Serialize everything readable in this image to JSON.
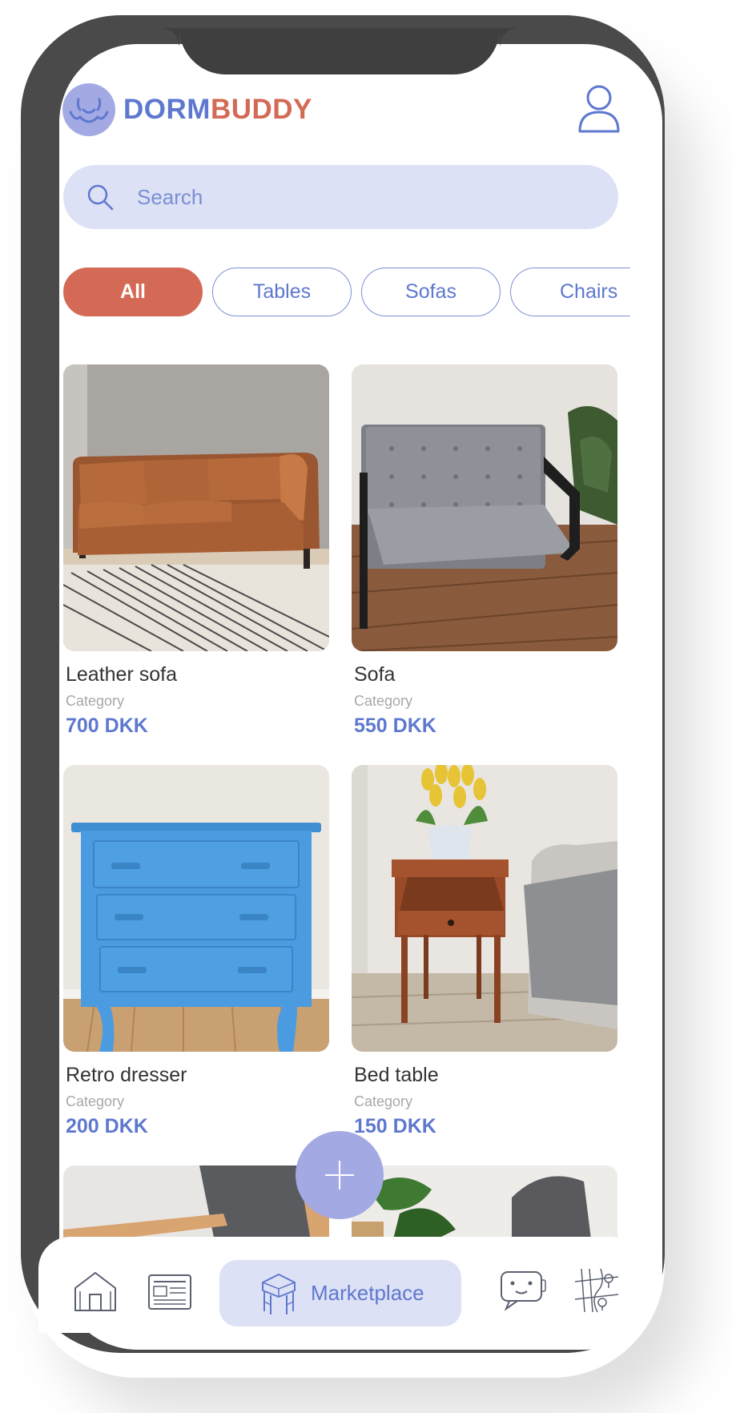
{
  "app": {
    "brand_part1": "DORM",
    "brand_part2": "BUDDY",
    "icon": "dormbuddy-logo-icon",
    "accent": "#5e78cf",
    "brand_accent": "#d46a55"
  },
  "header": {
    "profile_icon": "user-profile-icon"
  },
  "search": {
    "placeholder": "Search",
    "value": ""
  },
  "filters": [
    {
      "label": "All",
      "active": true
    },
    {
      "label": "Tables",
      "active": false
    },
    {
      "label": "Sofas",
      "active": false
    },
    {
      "label": "Chairs",
      "active": false
    }
  ],
  "products": [
    {
      "name": "Leather sofa",
      "category": "Category",
      "price": "700 DKK",
      "image": "leather-sofa-photo"
    },
    {
      "name": "Sofa",
      "category": "Category",
      "price": "550 DKK",
      "image": "grey-sofa-photo"
    },
    {
      "name": "Retro dresser",
      "category": "Category",
      "price": "200 DKK",
      "image": "blue-dresser-photo"
    },
    {
      "name": "Bed table",
      "category": "Category",
      "price": "150 DKK",
      "image": "bed-table-photo"
    }
  ],
  "fab": {
    "icon": "plus-icon"
  },
  "nav": {
    "items": [
      {
        "icon": "home-icon"
      },
      {
        "icon": "newspaper-icon"
      },
      {
        "icon": "marketplace-icon",
        "label": "Marketplace",
        "active": true
      },
      {
        "icon": "chat-bot-icon"
      },
      {
        "icon": "map-icon"
      }
    ]
  }
}
